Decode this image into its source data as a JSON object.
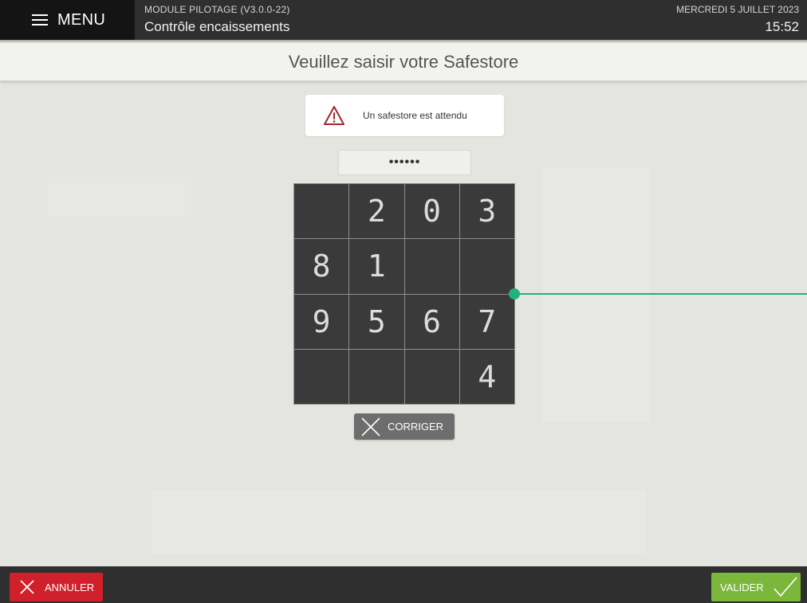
{
  "topbar": {
    "menu_label": "MENU",
    "module_title": "MODULE PILOTAGE (V3.0.0-22)",
    "module_subtitle": "Contrôle encaissements",
    "date": "MERCREDI 5 JUILLET 2023",
    "time": "15:52"
  },
  "header": {
    "title": "Veuillez saisir votre Safestore"
  },
  "alert": {
    "message": "Un safestore est attendu"
  },
  "code_field": {
    "value": "••••••"
  },
  "keypad": {
    "keys": [
      "",
      "2",
      "0",
      "3",
      "8",
      "1",
      "",
      "",
      "9",
      "5",
      "6",
      "7",
      "",
      "",
      "",
      "4"
    ]
  },
  "actions": {
    "correct_label": "CORRIGER",
    "cancel_label": "ANNULER",
    "validate_label": "VALIDER"
  },
  "colors": {
    "cancel": "#d0202c",
    "validate": "#7ab73a",
    "connector": "#23b07a",
    "warning": "#a0282e"
  }
}
